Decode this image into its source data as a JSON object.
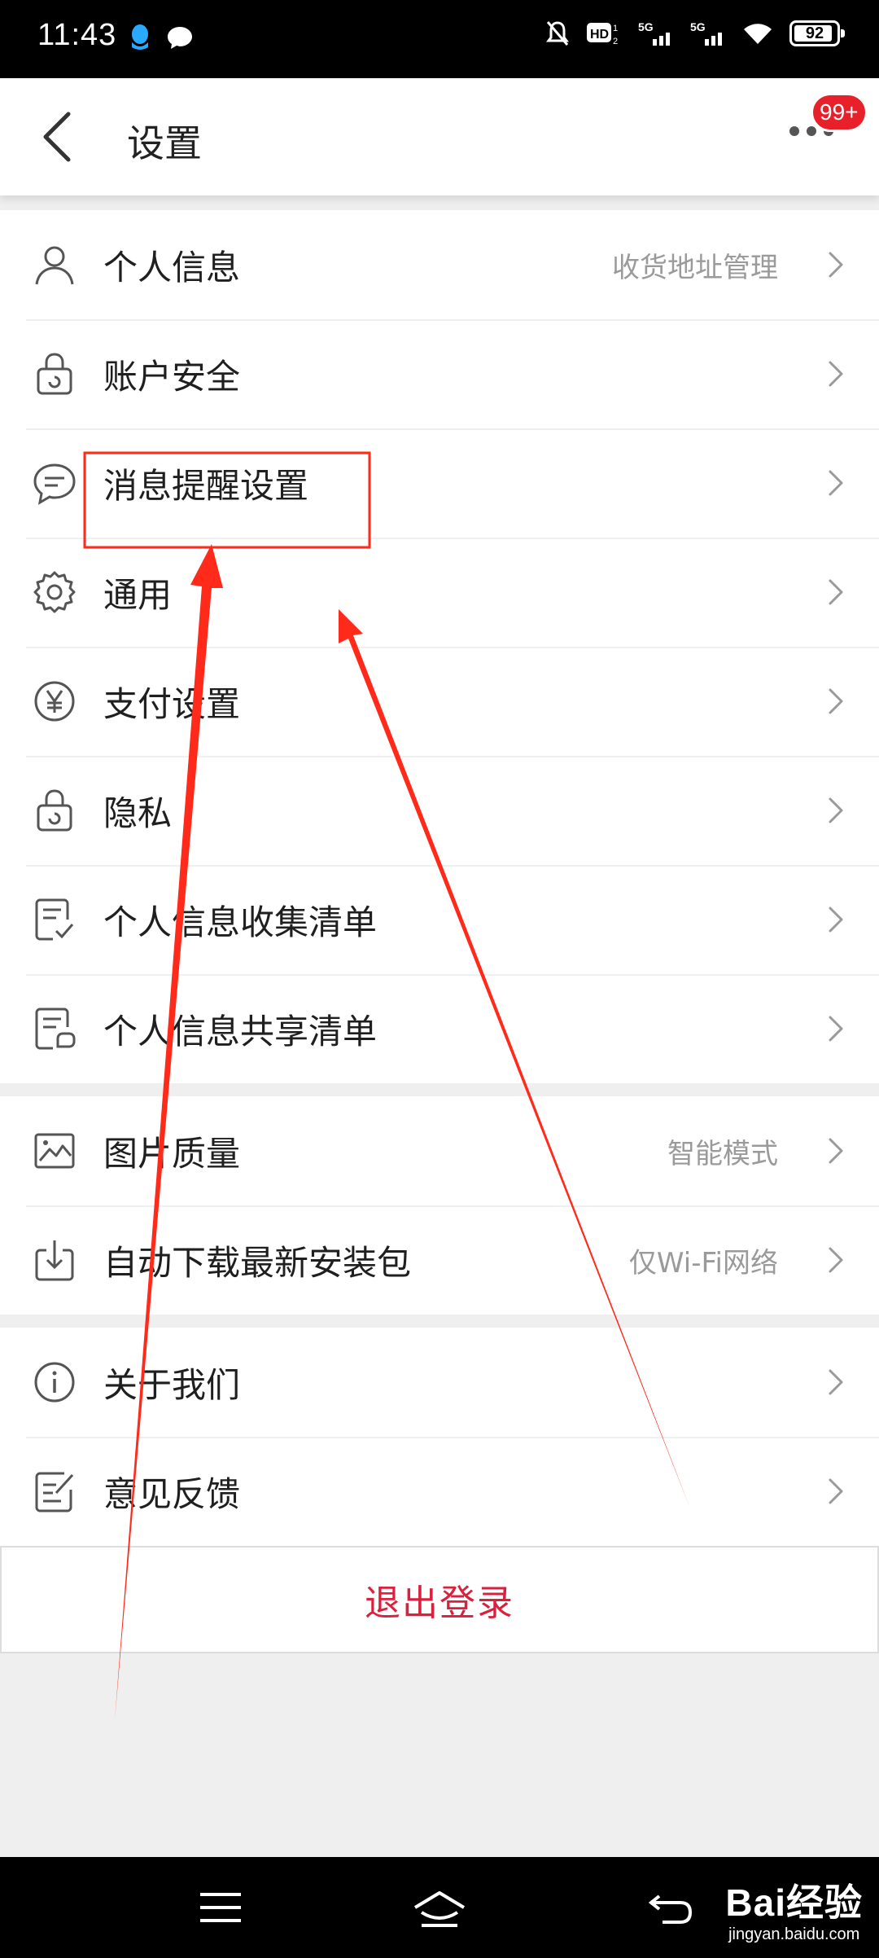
{
  "status_bar": {
    "time": "11:43",
    "battery": "92",
    "battery_level": 0.92,
    "left_icons": [
      "qq-icon",
      "message-bubble-icon"
    ],
    "right_icons": [
      "mute-bell-icon",
      "hd-icon",
      "5g-signal-icon",
      "5g-signal-icon",
      "wifi-icon",
      "battery-icon"
    ]
  },
  "header": {
    "title": "设置",
    "badge": "99+"
  },
  "groups": [
    {
      "items": [
        {
          "icon": "user-icon",
          "label": "个人信息",
          "value": "收货地址管理"
        },
        {
          "icon": "lock-icon",
          "label": "账户安全",
          "value": ""
        },
        {
          "icon": "chat-bubble-icon",
          "label": "消息提醒设置",
          "value": ""
        },
        {
          "icon": "gear-icon",
          "label": "通用",
          "value": ""
        },
        {
          "icon": "yen-icon",
          "label": "支付设置",
          "value": ""
        },
        {
          "icon": "lock-icon",
          "label": "隐私",
          "value": ""
        },
        {
          "icon": "checklist-icon",
          "label": "个人信息收集清单",
          "value": ""
        },
        {
          "icon": "share-list-icon",
          "label": "个人信息共享清单",
          "value": ""
        }
      ]
    },
    {
      "items": [
        {
          "icon": "image-icon",
          "label": "图片质量",
          "value": "智能模式"
        },
        {
          "icon": "download-icon",
          "label": "自动下载最新安装包",
          "value": "仅Wi-Fi网络"
        }
      ]
    },
    {
      "items": [
        {
          "icon": "info-icon",
          "label": "关于我们",
          "value": ""
        },
        {
          "icon": "feedback-icon",
          "label": "意见反馈",
          "value": ""
        }
      ]
    }
  ],
  "logout_label": "退出登录",
  "watermark": {
    "logo": "Bai经验",
    "site": "jingyan.baidu.com"
  },
  "colors": {
    "accent_red": "#d9203c",
    "badge_red": "#e8202a",
    "annotation_red": "#ff2a1a"
  }
}
